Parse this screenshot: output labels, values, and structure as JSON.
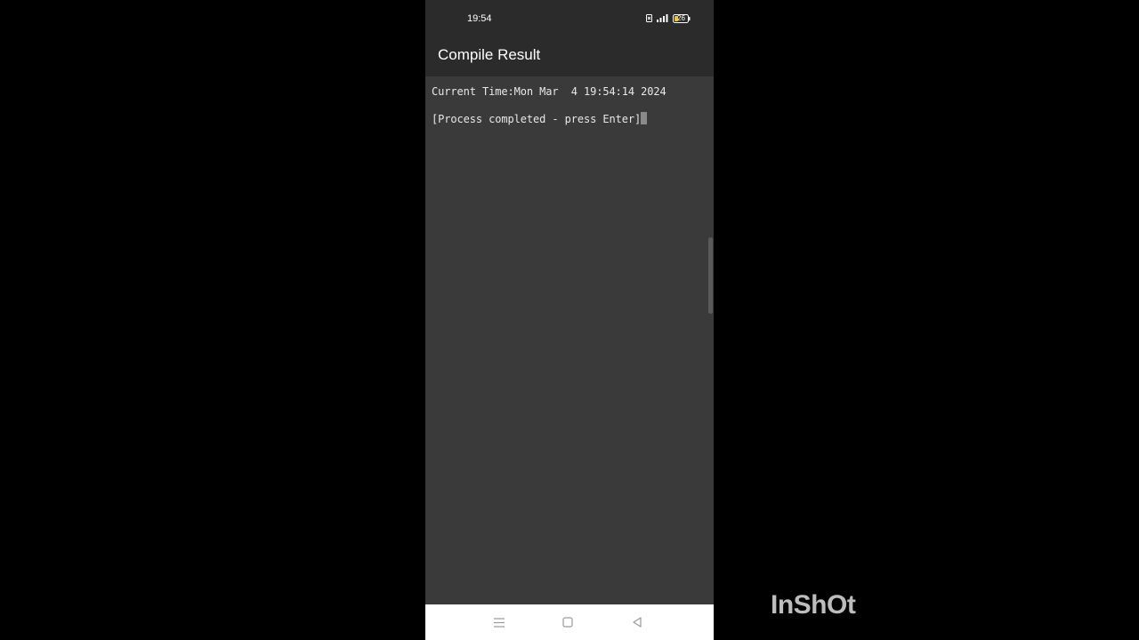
{
  "status_bar": {
    "time": "19:54",
    "battery_level": "26",
    "icons": [
      "sim-icon",
      "signal-icon",
      "battery-icon"
    ]
  },
  "app_bar": {
    "title": "Compile Result"
  },
  "terminal": {
    "lines": [
      "Current Time:Mon Mar  4 19:54:14 2024",
      "[Process completed - press Enter]"
    ]
  },
  "nav_bar": {
    "icons": [
      "menu-icon",
      "home-icon",
      "back-icon"
    ]
  },
  "watermark": {
    "text": "InShOt"
  },
  "colors": {
    "background": "#000000",
    "terminal_bg": "#3a3a3a",
    "bar_bg": "#2b2b2b",
    "text": "#e8e8e8",
    "nav_bg": "#ffffff"
  }
}
